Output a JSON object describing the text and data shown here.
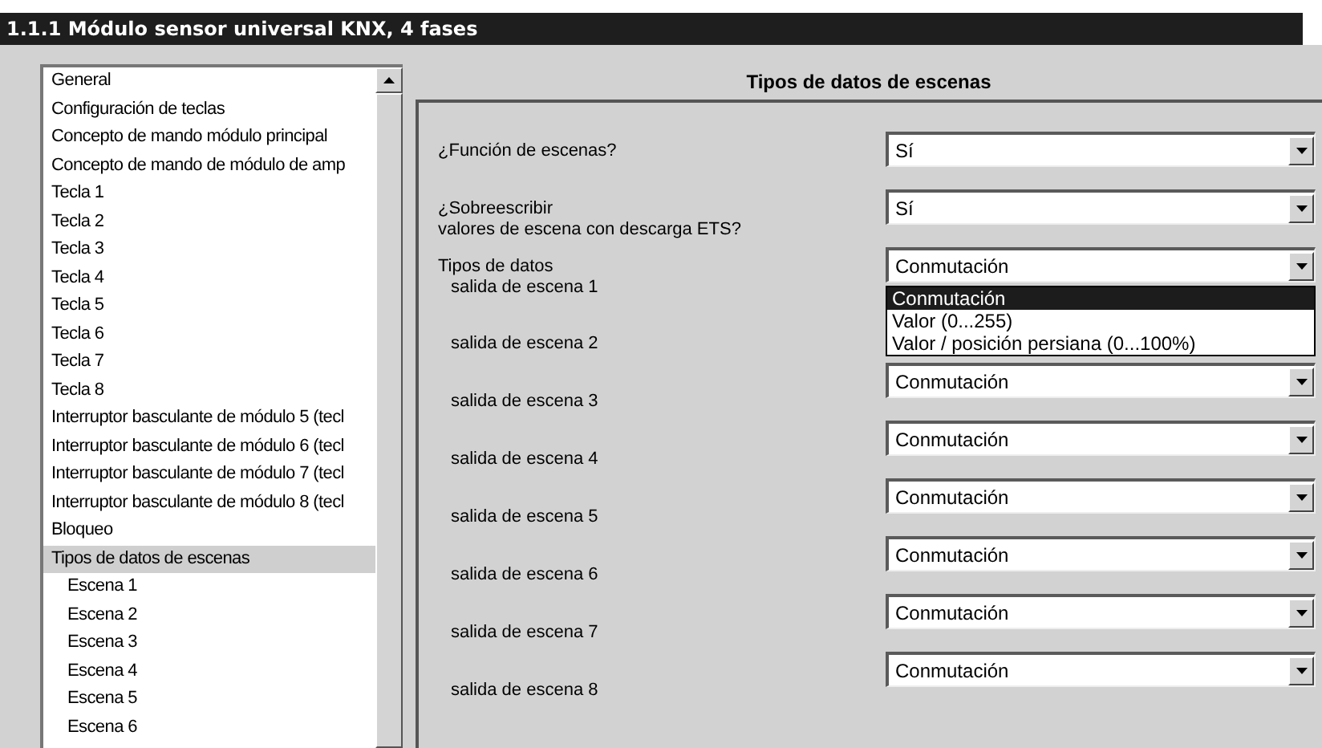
{
  "window": {
    "title": "1.1.1 Módulo sensor universal KNX, 4 fases"
  },
  "sidebar": {
    "items": [
      {
        "label": "General",
        "selected": false
      },
      {
        "label": "Configuración de teclas",
        "selected": false
      },
      {
        "label": "Concepto de mando módulo principal",
        "selected": false
      },
      {
        "label": "Concepto de mando de módulo de amp",
        "selected": false
      },
      {
        "label": "Tecla 1",
        "selected": false
      },
      {
        "label": "Tecla 2",
        "selected": false
      },
      {
        "label": "Tecla 3",
        "selected": false
      },
      {
        "label": "Tecla 4",
        "selected": false
      },
      {
        "label": "Tecla 5",
        "selected": false
      },
      {
        "label": "Tecla 6",
        "selected": false
      },
      {
        "label": "Tecla 7",
        "selected": false
      },
      {
        "label": "Tecla 8",
        "selected": false
      },
      {
        "label": "Interruptor basculante de módulo 5 (tecl",
        "selected": false
      },
      {
        "label": "Interruptor basculante de módulo 6 (tecl",
        "selected": false
      },
      {
        "label": "Interruptor basculante de módulo 7 (tecl",
        "selected": false
      },
      {
        "label": "Interruptor basculante de módulo 8 (tecl",
        "selected": false
      },
      {
        "label": "Bloqueo",
        "selected": false
      },
      {
        "label": "Tipos de datos de escenas",
        "selected": true,
        "children": [
          {
            "label": "Escena 1",
            "selected": false
          },
          {
            "label": "Escena 2",
            "selected": false
          },
          {
            "label": "Escena 3",
            "selected": false
          },
          {
            "label": "Escena 4",
            "selected": false
          },
          {
            "label": "Escena 5",
            "selected": false
          },
          {
            "label": "Escena 6",
            "selected": false
          }
        ]
      }
    ]
  },
  "panel": {
    "title": "Tipos de datos de escenas",
    "rows": [
      {
        "label": "¿Función de escenas?",
        "value": "Sí"
      },
      {
        "label": "¿Sobreescribir\nvalores de escena con descarga ETS?",
        "value": "Sí"
      },
      {
        "heading": "Tipos de datos",
        "label": "salida de escena 1",
        "value": "Conmutación",
        "expanded": true,
        "options": [
          {
            "label": "Conmutación",
            "selected": true
          },
          {
            "label": "Valor (0...255)",
            "selected": false
          },
          {
            "label": "Valor / posición persiana (0...100%)",
            "selected": false
          }
        ]
      },
      {
        "label": "salida de escena 2"
      },
      {
        "label": "salida de escena 3",
        "value": "Conmutación"
      },
      {
        "label": "salida de escena 4",
        "value": "Conmutación"
      },
      {
        "label": "salida de escena 5",
        "value": "Conmutación"
      },
      {
        "label": "salida de escena 6",
        "value": "Conmutación"
      },
      {
        "label": "salida de escena 7",
        "value": "Conmutación"
      },
      {
        "label": "salida de escena 8",
        "value": "Conmutación"
      }
    ]
  }
}
